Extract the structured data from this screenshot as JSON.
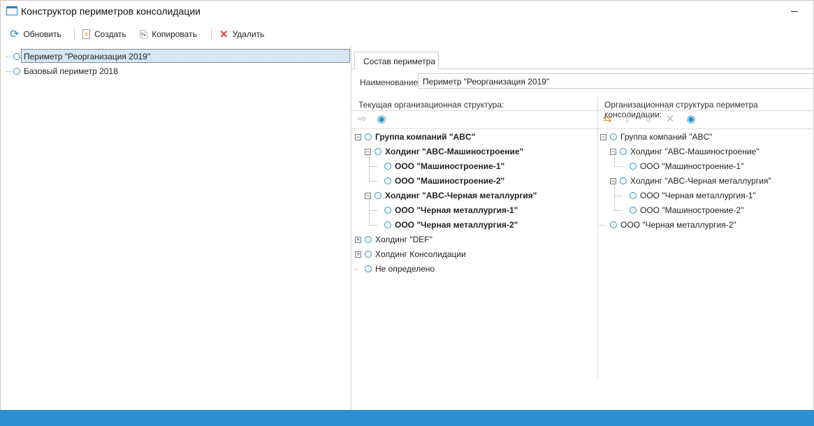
{
  "window": {
    "title": "Конструктор периметров консолидации"
  },
  "toolbar": {
    "refresh": "Обновить",
    "create": "Создать",
    "copy": "Копировать",
    "delete": "Удалить"
  },
  "perimeters": [
    {
      "label": "Периметр \"Реорганизация 2019\"",
      "selected": true
    },
    {
      "label": "Базовый периметр 2018",
      "selected": false
    }
  ],
  "tab": {
    "label": "Состав периметра"
  },
  "name": {
    "label": "Наименование",
    "value": "Периметр \"Реорганизация 2019\""
  },
  "current": {
    "header": "Текущая организационная структура:",
    "tools": [
      "arrow-right-icon",
      "eye-icon"
    ],
    "tree": [
      {
        "label": "Группа компаний \"ABC\"",
        "level": 0,
        "exp": "-",
        "bold": true
      },
      {
        "label": "Холдинг \"ABC-Машиностроение\"",
        "level": 1,
        "exp": "-",
        "bold": true
      },
      {
        "label": "ООО \"Машиностроение-1\"",
        "level": 2,
        "bold": true
      },
      {
        "label": "ООО \"Машиностроение-2\"",
        "level": 2,
        "bold": true
      },
      {
        "label": "Холдинг \"ABC-Черная металлургия\"",
        "level": 1,
        "exp": "-",
        "bold": true
      },
      {
        "label": "ООО \"Черная металлургия-1\"",
        "level": 2,
        "bold": true
      },
      {
        "label": "ООО \"Черная металлургия-2\"",
        "level": 2,
        "bold": true
      },
      {
        "label": "Холдинг \"DEF\"",
        "level": 0,
        "exp": "+"
      },
      {
        "label": "Холдинг Консолидации",
        "level": 0,
        "exp": "+"
      },
      {
        "label": "Не определено",
        "level": 0
      }
    ]
  },
  "perimeter_structure": {
    "header": "Организационная структура периметра консолидации:",
    "tools": [
      "sync-icon",
      "move-up-icon",
      "move-down-icon",
      "remove-icon",
      "eye-icon"
    ],
    "tree": [
      {
        "label": "Группа компаний \"ABC\"",
        "level": 0,
        "exp": "-"
      },
      {
        "label": "Холдинг \"ABC-Машиностроение\"",
        "level": 1,
        "exp": "-"
      },
      {
        "label": "ООО \"Машиностроение-1\"",
        "level": 2
      },
      {
        "label": "Холдинг \"ABC-Черная металлургия\"",
        "level": 1,
        "exp": "-"
      },
      {
        "label": "ООО \"Черная металлургия-1\"",
        "level": 2
      },
      {
        "label": "ООО \"Машиностроение-2\"",
        "level": 2
      },
      {
        "label": "ООО \"Черная металлургия-2\"",
        "level": 0
      }
    ]
  },
  "colors": {
    "accent": "#2b8fd0",
    "selection": "#d5e6f5",
    "delete": "#e04040",
    "sync": "#e8882a"
  }
}
